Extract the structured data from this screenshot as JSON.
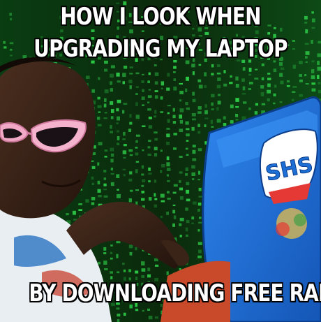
{
  "caption": {
    "top_line1": "HOW I LOOK WHEN",
    "top_line2": "UPGRADING MY LAPTOP",
    "bottom": "BY DOWNLOADING FREE RAM"
  },
  "laptop": {
    "logo_text": "SHS"
  },
  "colors": {
    "matrix_green": "#2fd24a",
    "laptop_blue": "#1d6fd6",
    "sunglasses_pink": "#f2a9c6",
    "skin": "#3a2418"
  }
}
